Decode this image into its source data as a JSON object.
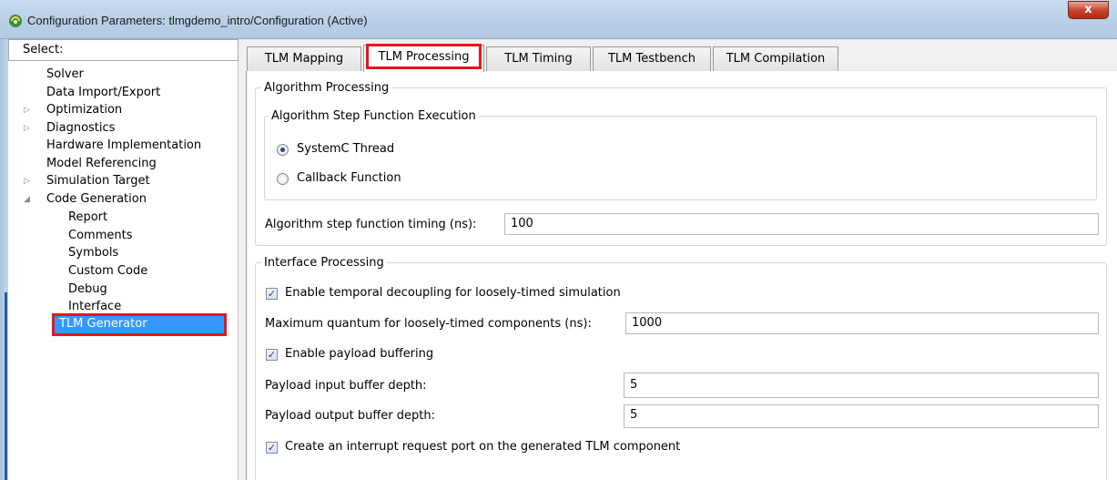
{
  "window": {
    "title": "Configuration Parameters: tlmgdemo_intro/Configuration (Active)",
    "close_label": "x"
  },
  "tree": {
    "header": "Select:",
    "items": [
      {
        "label": "Solver",
        "indent": 0,
        "arrow": ""
      },
      {
        "label": "Data Import/Export",
        "indent": 0,
        "arrow": ""
      },
      {
        "label": "Optimization",
        "indent": 0,
        "arrow": "▷"
      },
      {
        "label": "Diagnostics",
        "indent": 0,
        "arrow": "▷"
      },
      {
        "label": "Hardware Implementation",
        "indent": 0,
        "arrow": ""
      },
      {
        "label": "Model Referencing",
        "indent": 0,
        "arrow": ""
      },
      {
        "label": "Simulation Target",
        "indent": 0,
        "arrow": "▷"
      },
      {
        "label": "Code Generation",
        "indent": 0,
        "arrow": "◢"
      },
      {
        "label": "Report",
        "indent": 1,
        "arrow": ""
      },
      {
        "label": "Comments",
        "indent": 1,
        "arrow": ""
      },
      {
        "label": "Symbols",
        "indent": 1,
        "arrow": ""
      },
      {
        "label": "Custom Code",
        "indent": 1,
        "arrow": ""
      },
      {
        "label": "Debug",
        "indent": 1,
        "arrow": ""
      },
      {
        "label": "Interface",
        "indent": 1,
        "arrow": ""
      },
      {
        "label": "TLM Generator",
        "indent": 1,
        "arrow": "",
        "selected": true
      }
    ]
  },
  "tabs": [
    {
      "label": "TLM Mapping"
    },
    {
      "label": "TLM Processing",
      "active": true
    },
    {
      "label": "TLM Timing"
    },
    {
      "label": "TLM Testbench"
    },
    {
      "label": "TLM Compilation"
    }
  ],
  "algorithm": {
    "group_title": "Algorithm Processing",
    "step_group_title": "Algorithm Step Function Execution",
    "radio_systemc": "SystemC Thread",
    "radio_callback": "Callback Function",
    "selected_radio": "SystemC Thread",
    "timing_label": "Algorithm step function timing (ns):",
    "timing_value": "100"
  },
  "interface": {
    "group_title": "Interface Processing",
    "decoupling_label": "Enable temporal decoupling for loosely-timed simulation",
    "decoupling_checked": true,
    "quantum_label": "Maximum quantum for loosely-timed components (ns):",
    "quantum_value": "1000",
    "buffering_label": "Enable payload buffering",
    "buffering_checked": true,
    "input_depth_label": "Payload input buffer depth:",
    "input_depth_value": "5",
    "output_depth_label": "Payload output buffer depth:",
    "output_depth_value": "5",
    "irq_label": "Create an interrupt request port on the generated TLM component",
    "irq_checked": true
  },
  "colors": {
    "selection": "#3399ff",
    "highlight_box": "#e8141c",
    "titlebar": "#b9cfe6",
    "close_button": "#c7452f"
  }
}
